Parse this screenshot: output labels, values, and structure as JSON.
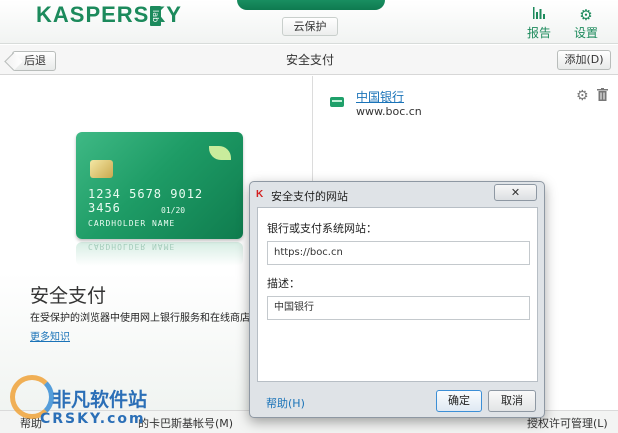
{
  "app": {
    "logo_text": "KASPERSKY",
    "logo_lab": "lab",
    "cloud_button": "云保护",
    "report_label": "报告",
    "settings_label": "设置",
    "report_icon": "bar-chart-icon",
    "settings_icon": "gear-icon",
    "brand_color": "#1c8a5c"
  },
  "toolbar": {
    "back_label": "后退",
    "title": "安全支付",
    "add_label": "添加(D)"
  },
  "left_panel": {
    "card": {
      "number": "1234 5678 9012 3456",
      "valid": "01/20",
      "holder": "CARDHOLDER NAME"
    },
    "title": "安全支付",
    "description": "在受保护的浏览器中使用网上银行服务和在线商店",
    "more_link": "更多知识"
  },
  "sites": [
    {
      "name": "中国银行",
      "url": "www.boc.cn"
    }
  ],
  "footer": {
    "help": "帮助",
    "account": "的卡巴斯基帐号(M)",
    "license": "授权许可管理(L)"
  },
  "watermark": {
    "line1": "非凡软件站",
    "line2": "CRSKY.com"
  },
  "dialog": {
    "title": "安全支付的网站",
    "close_label": "✕",
    "url_label": "银行或支付系统网站：",
    "url_value": "https://boc.cn",
    "desc_label": "描述：",
    "desc_value": "中国银行",
    "help": "帮助(H)",
    "ok": "确定",
    "cancel": "取消"
  }
}
